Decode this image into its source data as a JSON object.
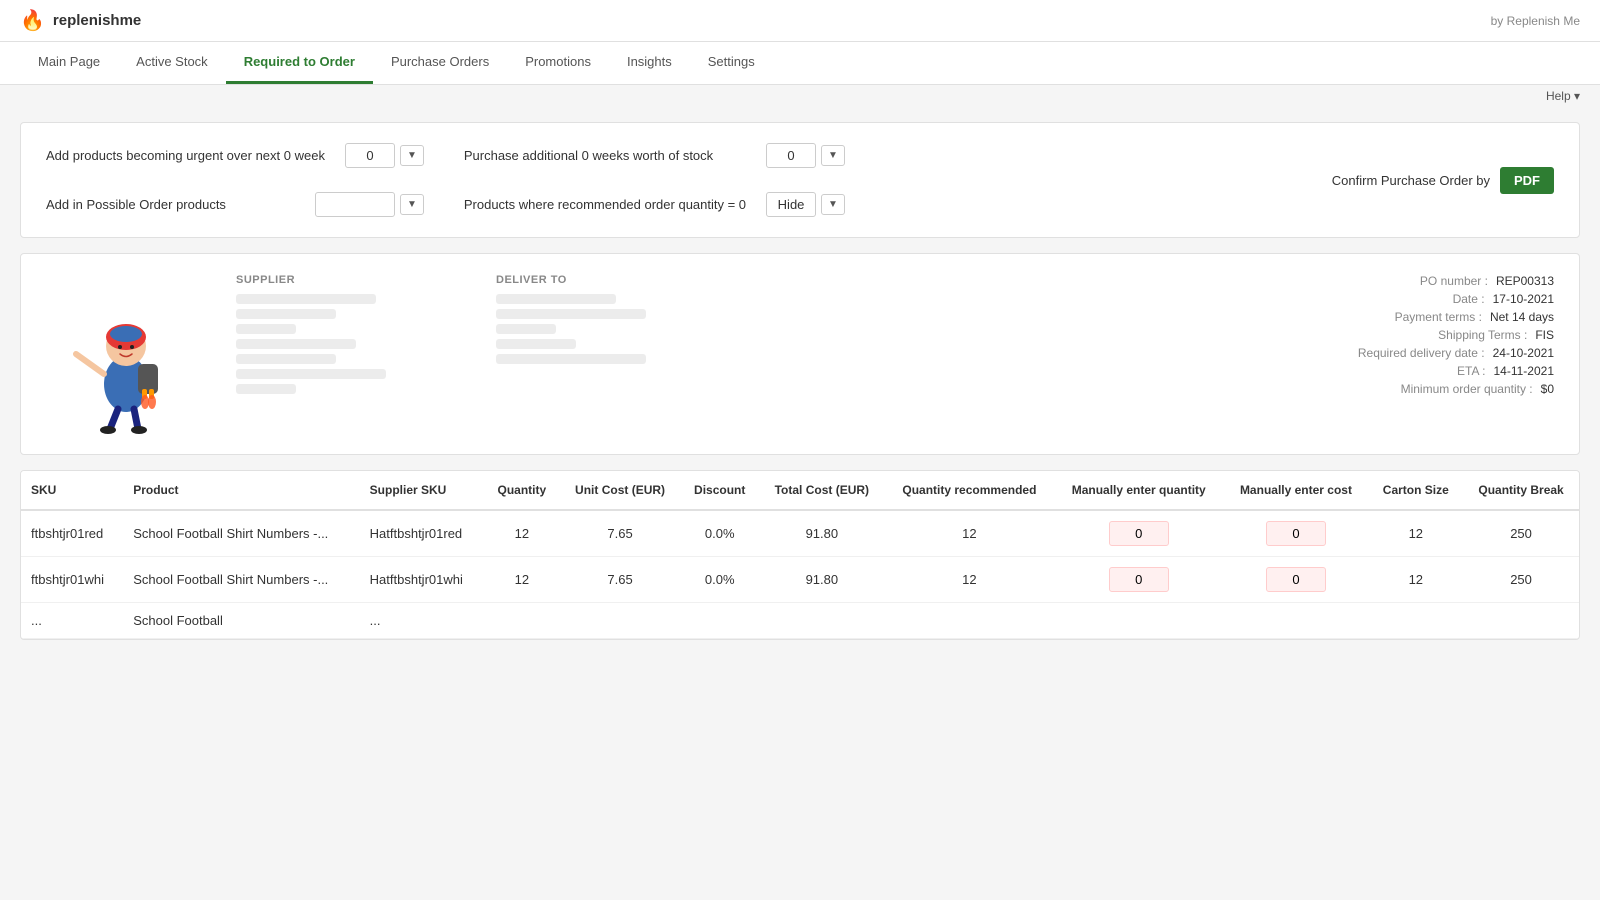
{
  "app": {
    "title": "replenishme",
    "by_text": "by Replenish Me"
  },
  "nav": {
    "items": [
      {
        "id": "main-page",
        "label": "Main Page",
        "active": false
      },
      {
        "id": "active-stock",
        "label": "Active Stock",
        "active": false
      },
      {
        "id": "required-to-order",
        "label": "Required to Order",
        "active": true
      },
      {
        "id": "purchase-orders",
        "label": "Purchase Orders",
        "active": false
      },
      {
        "id": "promotions",
        "label": "Promotions",
        "active": false
      },
      {
        "id": "insights",
        "label": "Insights",
        "active": false
      },
      {
        "id": "settings",
        "label": "Settings",
        "active": false
      }
    ]
  },
  "help": {
    "label": "Help ▾"
  },
  "filters": {
    "urgent_label": "Add products becoming urgent over next 0 week",
    "urgent_value": "0",
    "possible_label": "Add in Possible Order products",
    "possible_value": "",
    "purchase_label": "Purchase additional 0 weeks worth of stock",
    "purchase_value": "0",
    "recommended_label": "Products where recommended order quantity = 0",
    "recommended_value": "Hide",
    "confirm_label": "Confirm Purchase Order by",
    "pdf_label": "PDF"
  },
  "po_info": {
    "po_number_label": "PO number :",
    "po_number_val": "REP00313",
    "date_label": "Date :",
    "date_val": "17-10-2021",
    "payment_label": "Payment terms :",
    "payment_val": "Net 14 days",
    "shipping_label": "Shipping Terms :",
    "shipping_val": "FIS",
    "delivery_label": "Required delivery date :",
    "delivery_val": "24-10-2021",
    "eta_label": "ETA :",
    "eta_val": "14-11-2021",
    "min_order_label": "Minimum order quantity :",
    "min_order_val": "$0"
  },
  "supplier_section": {
    "label": "SUPPLIER"
  },
  "deliver_section": {
    "label": "DELIVER TO"
  },
  "table": {
    "columns": [
      {
        "id": "sku",
        "label": "SKU"
      },
      {
        "id": "product",
        "label": "Product"
      },
      {
        "id": "supplier-sku",
        "label": "Supplier SKU"
      },
      {
        "id": "quantity",
        "label": "Quantity",
        "center": true
      },
      {
        "id": "unit-cost",
        "label": "Unit Cost (EUR)",
        "center": true
      },
      {
        "id": "discount",
        "label": "Discount",
        "center": true
      },
      {
        "id": "total-cost",
        "label": "Total Cost (EUR)",
        "center": true
      },
      {
        "id": "qty-recommended",
        "label": "Quantity recommended",
        "center": true
      },
      {
        "id": "manually-qty",
        "label": "Manually enter quantity",
        "center": true
      },
      {
        "id": "manually-cost",
        "label": "Manually enter cost",
        "center": true
      },
      {
        "id": "carton-size",
        "label": "Carton Size",
        "center": true
      },
      {
        "id": "qty-break",
        "label": "Quantity Break",
        "center": true
      }
    ],
    "rows": [
      {
        "sku": "ftbshtjr01red",
        "product": "School Football Shirt Numbers -...",
        "supplier_sku": "Hatftbshtjr01red",
        "quantity": "12",
        "unit_cost": "7.65",
        "discount": "0.0%",
        "total_cost": "91.80",
        "qty_recommended": "12",
        "manually_qty": "0",
        "manually_cost": "0",
        "carton_size": "12",
        "qty_break": "250"
      },
      {
        "sku": "ftbshtjr01whi",
        "product": "School Football Shirt Numbers -...",
        "supplier_sku": "Hatftbshtjr01whi",
        "quantity": "12",
        "unit_cost": "7.65",
        "discount": "0.0%",
        "total_cost": "91.80",
        "qty_recommended": "12",
        "manually_qty": "0",
        "manually_cost": "0",
        "carton_size": "12",
        "qty_break": "250"
      },
      {
        "sku": "...",
        "product": "School Football",
        "supplier_sku": "...",
        "quantity": "",
        "unit_cost": "",
        "discount": "",
        "total_cost": "",
        "qty_recommended": "",
        "manually_qty": "",
        "manually_cost": "",
        "carton_size": "",
        "qty_break": ""
      }
    ]
  }
}
